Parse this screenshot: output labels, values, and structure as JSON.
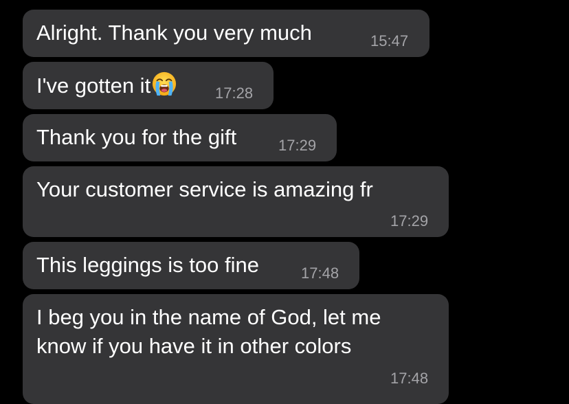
{
  "chat": {
    "messages": [
      {
        "text": "Alright. Thank you very much",
        "time": "15:47"
      },
      {
        "text": "I've gotten it",
        "emoji": "loudly-crying-face-icon",
        "time": "17:28"
      },
      {
        "text": "Thank you for the gift",
        "time": "17:29"
      },
      {
        "text": "Your customer service is amazing fr",
        "time": "17:29"
      },
      {
        "text": "This leggings is too fine",
        "time": "17:48"
      },
      {
        "text_line1": "I beg you in the name of God, let me",
        "text_line2": "know if you have it in other colors",
        "time": "17:48"
      }
    ]
  },
  "colors": {
    "background": "#000000",
    "bubble": "#353537",
    "text": "#ffffff",
    "timestamp": "#a4a4a8"
  }
}
